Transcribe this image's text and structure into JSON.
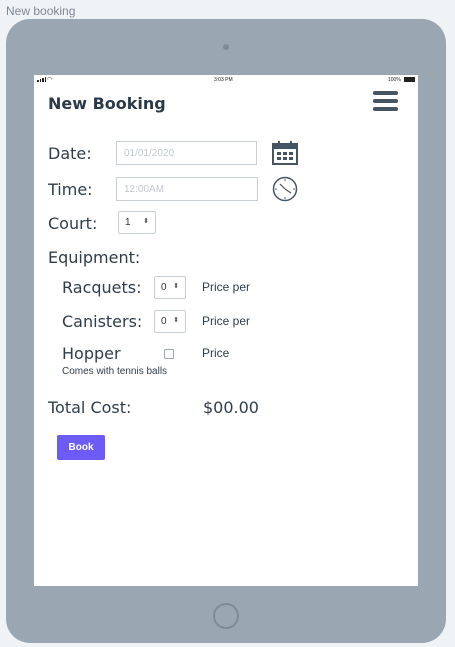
{
  "frame_title": "New booking",
  "status_bar": {
    "wifi_icon": "wifi-icon",
    "time": "3:03 PM",
    "battery": "100%"
  },
  "header": {
    "title": "New Booking",
    "menu_icon": "hamburger-menu-icon"
  },
  "form": {
    "date": {
      "label": "Date:",
      "placeholder": "01/01/2020",
      "icon": "calendar-icon"
    },
    "time": {
      "label": "Time:",
      "placeholder": "12:00AM",
      "icon": "clock-icon"
    },
    "court": {
      "label": "Court:",
      "selected": "1"
    },
    "equipment": {
      "label": "Equipment:",
      "racquets": {
        "label": "Racquets:",
        "selected": "0",
        "price": "Price per"
      },
      "canisters": {
        "label": "Canisters:",
        "selected": "0",
        "price": "Price per"
      },
      "hopper": {
        "label": "Hopper",
        "note": "Comes with tennis balls",
        "price": "Price",
        "checked": false
      }
    },
    "total": {
      "label": "Total Cost:",
      "value": "$00.00"
    },
    "book_label": "Book"
  },
  "colors": {
    "tablet_body": "#9aa7b3",
    "screen": "#ffffff",
    "primary_button": "#6c5cf5",
    "text": "#2f3d4a"
  }
}
